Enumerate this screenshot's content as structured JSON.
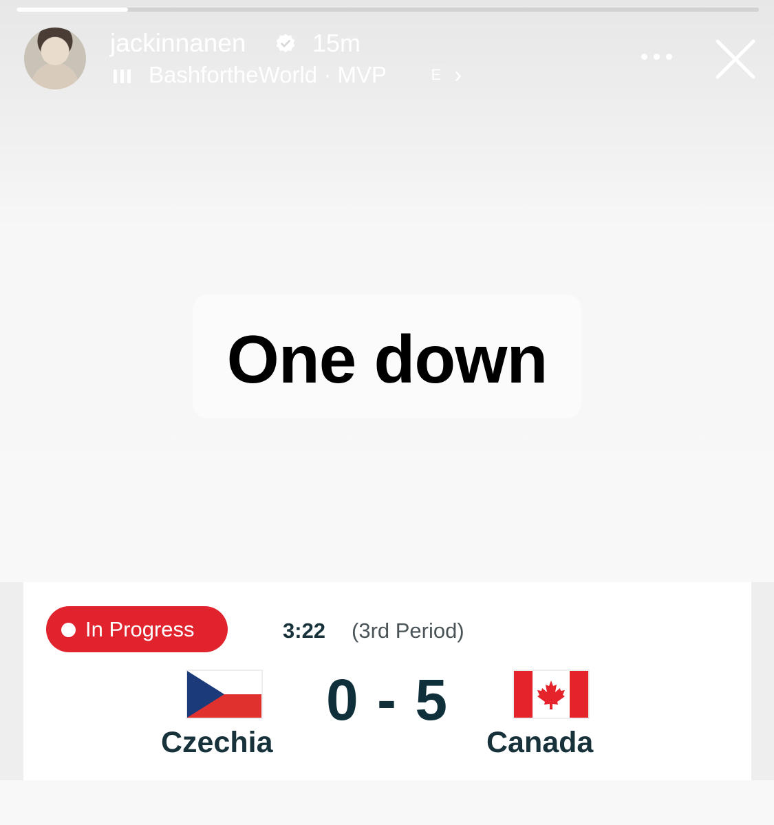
{
  "story": {
    "progress": 0.15,
    "username": "jackinnanen",
    "time_ago": "15m",
    "music": {
      "artist": "BashfortheWorld",
      "separator": "·",
      "track": "MVP",
      "explicit_label": "E"
    },
    "caption": "One down"
  },
  "scoreboard": {
    "status": "In Progress",
    "clock": "3:22",
    "period": "(3rd Period)",
    "home_team": "Czechia",
    "away_team": "Canada",
    "score": "0 - 5"
  },
  "colors": {
    "status_red": "#e1232e",
    "team_text": "#17323a",
    "canada_red": "#e4232b",
    "czech_blue": "#1a3a7a",
    "czech_red": "#e0312f"
  }
}
